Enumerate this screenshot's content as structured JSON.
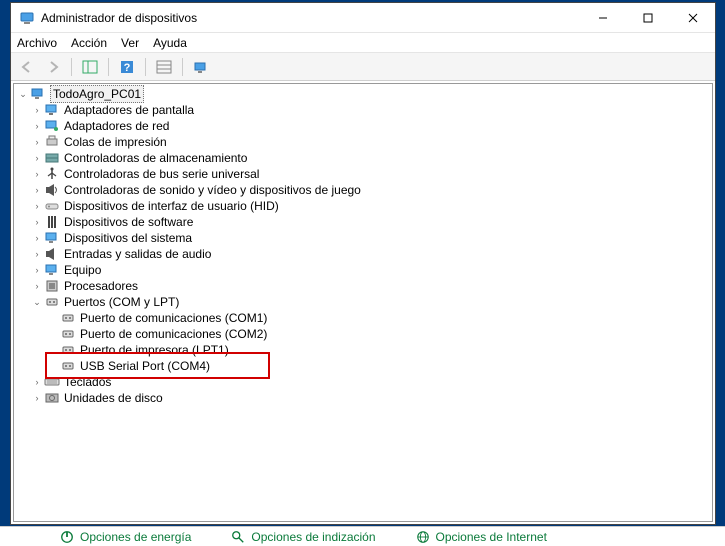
{
  "window": {
    "title": "Administrador de dispositivos"
  },
  "menu": {
    "file": "Archivo",
    "action": "Acción",
    "view": "Ver",
    "help": "Ayuda"
  },
  "tree": {
    "root": "TodoAgro_PC01",
    "items": [
      {
        "label": "Adaptadores de pantalla",
        "icon": "display"
      },
      {
        "label": "Adaptadores de red",
        "icon": "network"
      },
      {
        "label": "Colas de impresión",
        "icon": "printer"
      },
      {
        "label": "Controladoras de almacenamiento",
        "icon": "storage"
      },
      {
        "label": "Controladoras de bus serie universal",
        "icon": "usb"
      },
      {
        "label": "Controladoras de sonido y vídeo y dispositivos de juego",
        "icon": "sound"
      },
      {
        "label": "Dispositivos de interfaz de usuario (HID)",
        "icon": "hid"
      },
      {
        "label": "Dispositivos de software",
        "icon": "software"
      },
      {
        "label": "Dispositivos del sistema",
        "icon": "system"
      },
      {
        "label": "Entradas y salidas de audio",
        "icon": "audio"
      },
      {
        "label": "Equipo",
        "icon": "computer"
      },
      {
        "label": "Procesadores",
        "icon": "cpu"
      },
      {
        "label": "Puertos (COM y LPT)",
        "icon": "port",
        "expanded": true,
        "children": [
          {
            "label": "Puerto de comunicaciones (COM1)",
            "icon": "port"
          },
          {
            "label": "Puerto de comunicaciones (COM2)",
            "icon": "port"
          },
          {
            "label": "Puerto de impresora (LPT1)",
            "icon": "port"
          },
          {
            "label": "USB Serial Port (COM4)",
            "icon": "port"
          }
        ]
      },
      {
        "label": "Teclados",
        "icon": "keyboard"
      },
      {
        "label": "Unidades de disco",
        "icon": "disk"
      }
    ]
  },
  "taskbar": {
    "energy": "Opciones de energía",
    "indexing": "Opciones de indización",
    "internet": "Opciones de Internet"
  }
}
